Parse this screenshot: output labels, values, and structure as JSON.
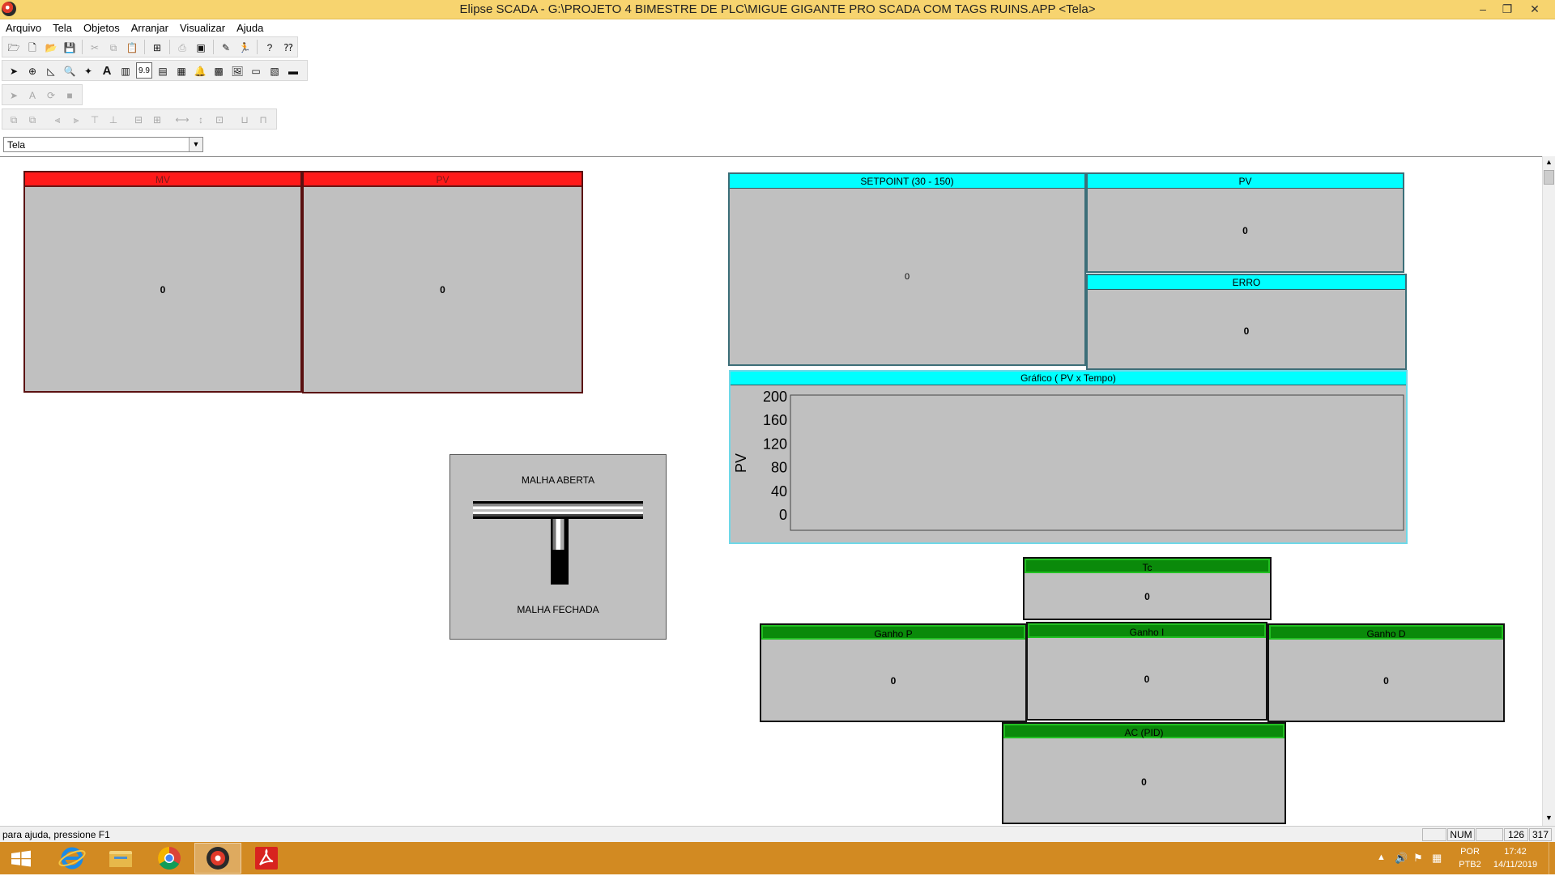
{
  "window": {
    "title": "Elipse SCADA - G:\\PROJETO 4 BIMESTRE DE PLC\\MIGUE GIGANTE PRO SCADA COM TAGS RUINS.APP <Tela>",
    "minimize": "–",
    "restore": "❐",
    "close": "✕"
  },
  "menu": [
    "Arquivo",
    "Tela",
    "Objetos",
    "Arranjar",
    "Visualizar",
    "Ajuda"
  ],
  "toolbar": {
    "label_tool_value": "9.9",
    "text_tool": "A"
  },
  "screen_selector": {
    "value": "Tela"
  },
  "panels": {
    "mv": {
      "header": "MV",
      "value": "0"
    },
    "pv_left": {
      "header": "PV",
      "value": "0"
    },
    "setpoint": {
      "header": "SETPOINT (30 - 150)",
      "value": "0"
    },
    "pv_right": {
      "header": "PV",
      "value": "0"
    },
    "erro": {
      "header": "ERRO",
      "value": "0"
    },
    "tc": {
      "header": "Tc",
      "value": "0"
    },
    "ganho_p": {
      "header": "Ganho P",
      "value": "0"
    },
    "ganho_i": {
      "header": "Ganho I",
      "value": "0"
    },
    "ganho_d": {
      "header": "Ganho D",
      "value": "0"
    },
    "ac_pid": {
      "header": "AC (PID)",
      "value": "0"
    }
  },
  "loop_switch": {
    "top_label": "MALHA ABERTA",
    "bottom_label": "MALHA FECHADA"
  },
  "chart_data": {
    "type": "line",
    "title": "Gráfico ( PV x Tempo)",
    "ylabel": "PV",
    "xlabel": "",
    "yticks": [
      200,
      160,
      120,
      80,
      40,
      0
    ],
    "ylim": [
      0,
      200
    ],
    "series": []
  },
  "statusbar": {
    "help": "para ajuda, pressione F1",
    "num": "NUM",
    "x": "126",
    "y": "317"
  },
  "taskbar": {
    "lang_top": "POR",
    "lang_bottom": "PTB2",
    "time": "17:42",
    "date": "14/11/2019"
  },
  "colors": {
    "accent_red": "#ff1a1a",
    "accent_cyan": "#00ffff",
    "accent_green": "#0a8a0a",
    "panel_gray": "#c0c0c0",
    "taskbar": "#d28a22"
  }
}
